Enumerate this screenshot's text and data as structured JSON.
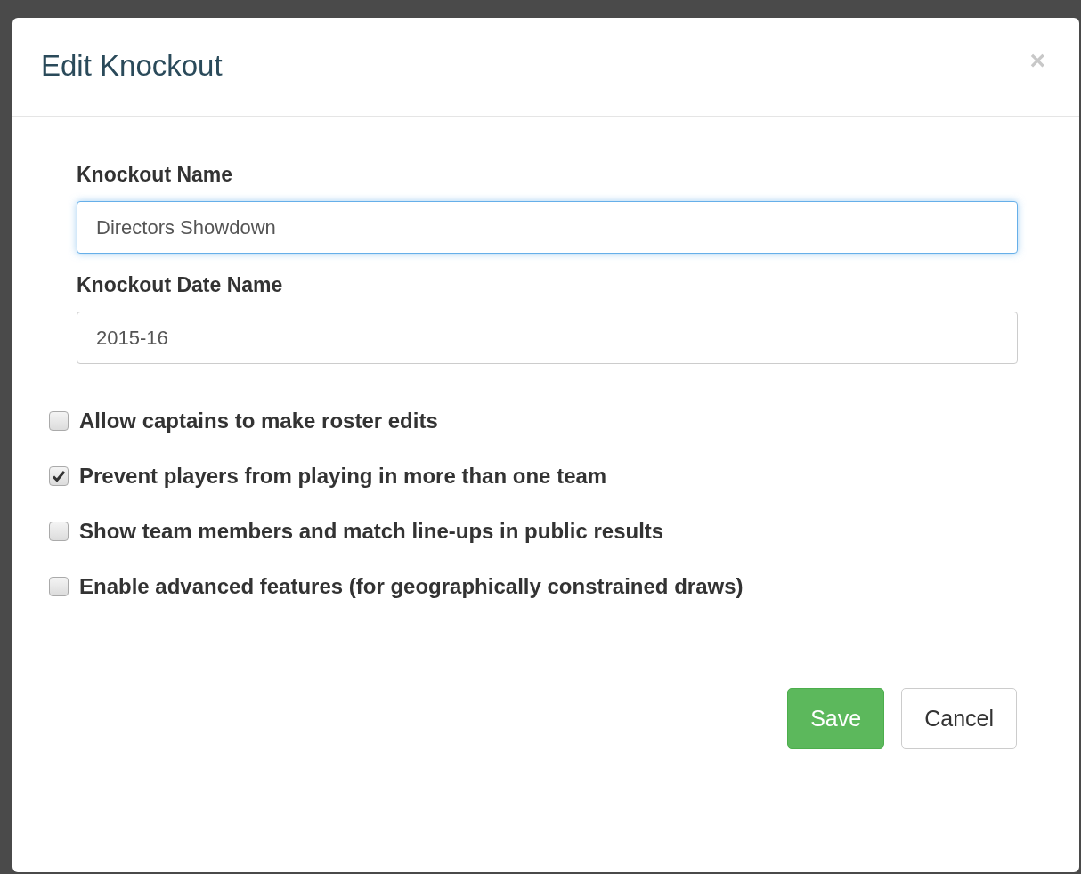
{
  "dialog": {
    "title": "Edit Knockout",
    "close": "×"
  },
  "fields": [
    {
      "label": "Knockout Name",
      "value": "Directors Showdown",
      "focused": true
    },
    {
      "label": "Knockout Date Name",
      "value": "2015-16",
      "focused": false
    }
  ],
  "options": [
    {
      "label": "Allow captains to make roster edits",
      "checked": false
    },
    {
      "label": "Prevent players from playing in more than one team",
      "checked": true
    },
    {
      "label": "Show team members and match line-ups in public results",
      "checked": false
    },
    {
      "label": "Enable advanced features (for geographically constrained draws)",
      "checked": false
    }
  ],
  "buttons": [
    {
      "label": "Save",
      "kind": "primary"
    },
    {
      "label": "Cancel",
      "kind": "default"
    }
  ]
}
